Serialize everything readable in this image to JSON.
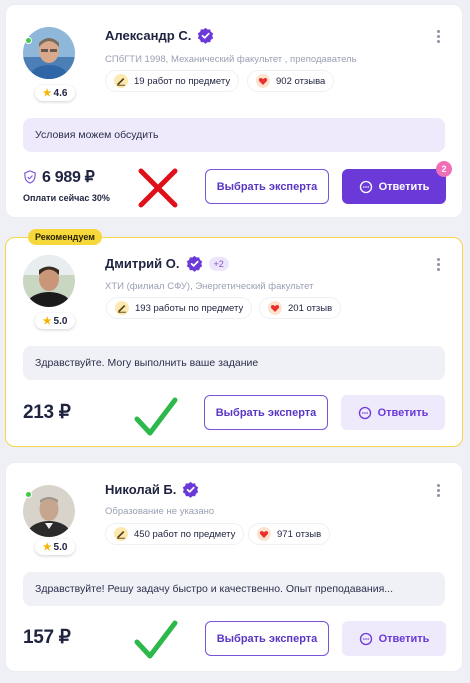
{
  "colors": {
    "accent": "#6a39d8",
    "accent_soft": "#efe9fc",
    "recommended_yellow": "#f7d83a",
    "online_green": "#41c94a",
    "cross_red": "#e0101a",
    "check_green": "#2cb84a"
  },
  "experts": [
    {
      "name": "Александр С.",
      "subtitle": "СПбГТИ 1998, Механический факультет , преподаватель",
      "rating": "4.6",
      "works": "19 работ по предмету",
      "reviews": "902 отзыва",
      "message": "Условия можем обсудить",
      "price": "6 989 ₽",
      "price_note": "Оплати сейчас 30%",
      "choose_label": "Выбрать эксперта",
      "reply_label": "Ответить",
      "reply_badge": "2",
      "online": true,
      "mark": "cross-mark-icon"
    },
    {
      "badge": "Рекомендуем",
      "name": "Дмитрий О.",
      "extra_badge": "+2",
      "subtitle": "ХТИ (филиал СФУ), Энергетический факультет",
      "rating": "5.0",
      "works": "193 работы по предмету",
      "reviews": "201 отзыв",
      "message": "Здравствуйте. Могу выполнить ваше задание",
      "price": "213 ₽",
      "choose_label": "Выбрать эксперта",
      "reply_label": "Ответить",
      "mark": "check-mark-icon"
    },
    {
      "name": "Николай Б.",
      "subtitle": "Образование не указано",
      "rating": "5.0",
      "works": "450 работ по предмету",
      "reviews": "971 отзыв",
      "message": "Здравствуйте! Решу задачу быстро и качественно. Опыт преподавания...",
      "price": "157 ₽",
      "choose_label": "Выбрать эксперта",
      "reply_label": "Ответить",
      "online": true,
      "mark": "check-mark-icon"
    }
  ]
}
